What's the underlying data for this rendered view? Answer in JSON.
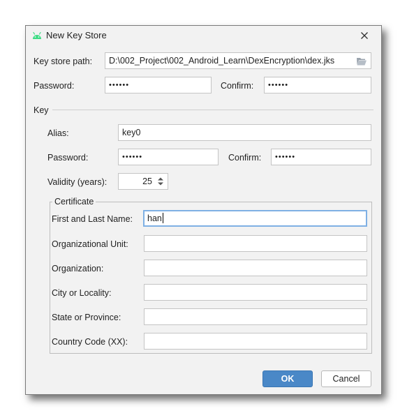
{
  "window": {
    "title": "New Key Store",
    "icon": "android-icon",
    "close_icon": "close-icon"
  },
  "keystore": {
    "path_label": "Key store path:",
    "path_value": "D:\\002_Project\\002_Android_Learn\\DexEncryption\\dex.jks",
    "browse_icon": "folder-open-icon",
    "password_label": "Password:",
    "password_value": "••••••",
    "confirm_label": "Confirm:",
    "confirm_value": "••••••"
  },
  "key": {
    "section_label": "Key",
    "alias_label": "Alias:",
    "alias_value": "key0",
    "password_label": "Password:",
    "password_value": "••••••",
    "confirm_label": "Confirm:",
    "confirm_value": "••••••",
    "validity_label": "Validity (years):",
    "validity_value": "25"
  },
  "certificate": {
    "legend": "Certificate",
    "first_last_label": "First and Last Name:",
    "first_last_value": "han",
    "org_unit_label": "Organizational Unit:",
    "org_unit_value": "",
    "org_label": "Organization:",
    "org_value": "",
    "city_label": "City or Locality:",
    "city_value": "",
    "state_label": "State or Province:",
    "state_value": "",
    "country_label": "Country Code (XX):",
    "country_value": ""
  },
  "buttons": {
    "ok": "OK",
    "cancel": "Cancel"
  },
  "colors": {
    "accent": "#4a88c7",
    "android": "#3ddc84",
    "focus_border": "#7fb0e4"
  }
}
